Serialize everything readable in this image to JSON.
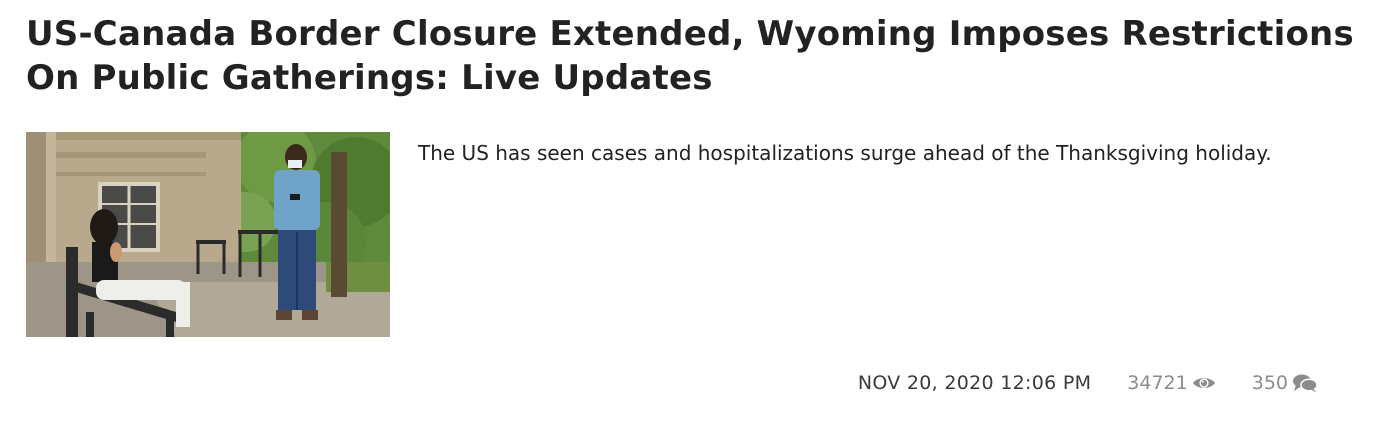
{
  "article": {
    "headline": "US-Canada Border Closure Extended, Wyoming Imposes Restrictions On Public Gatherings: Live Updates",
    "summary": "The US has seen cases and hospitalizations surge ahead of the Thanksgiving holiday.",
    "image_icon": "news-photo",
    "meta": {
      "date": "NOV 20, 2020 12:06 PM",
      "views": "34721",
      "views_icon": "eye-icon",
      "comments": "350",
      "comments_icon": "comments-icon"
    }
  },
  "colors": {
    "text": "#222222",
    "meta_date": "#3a3a3a",
    "meta_counts": "#8c8c8c"
  }
}
